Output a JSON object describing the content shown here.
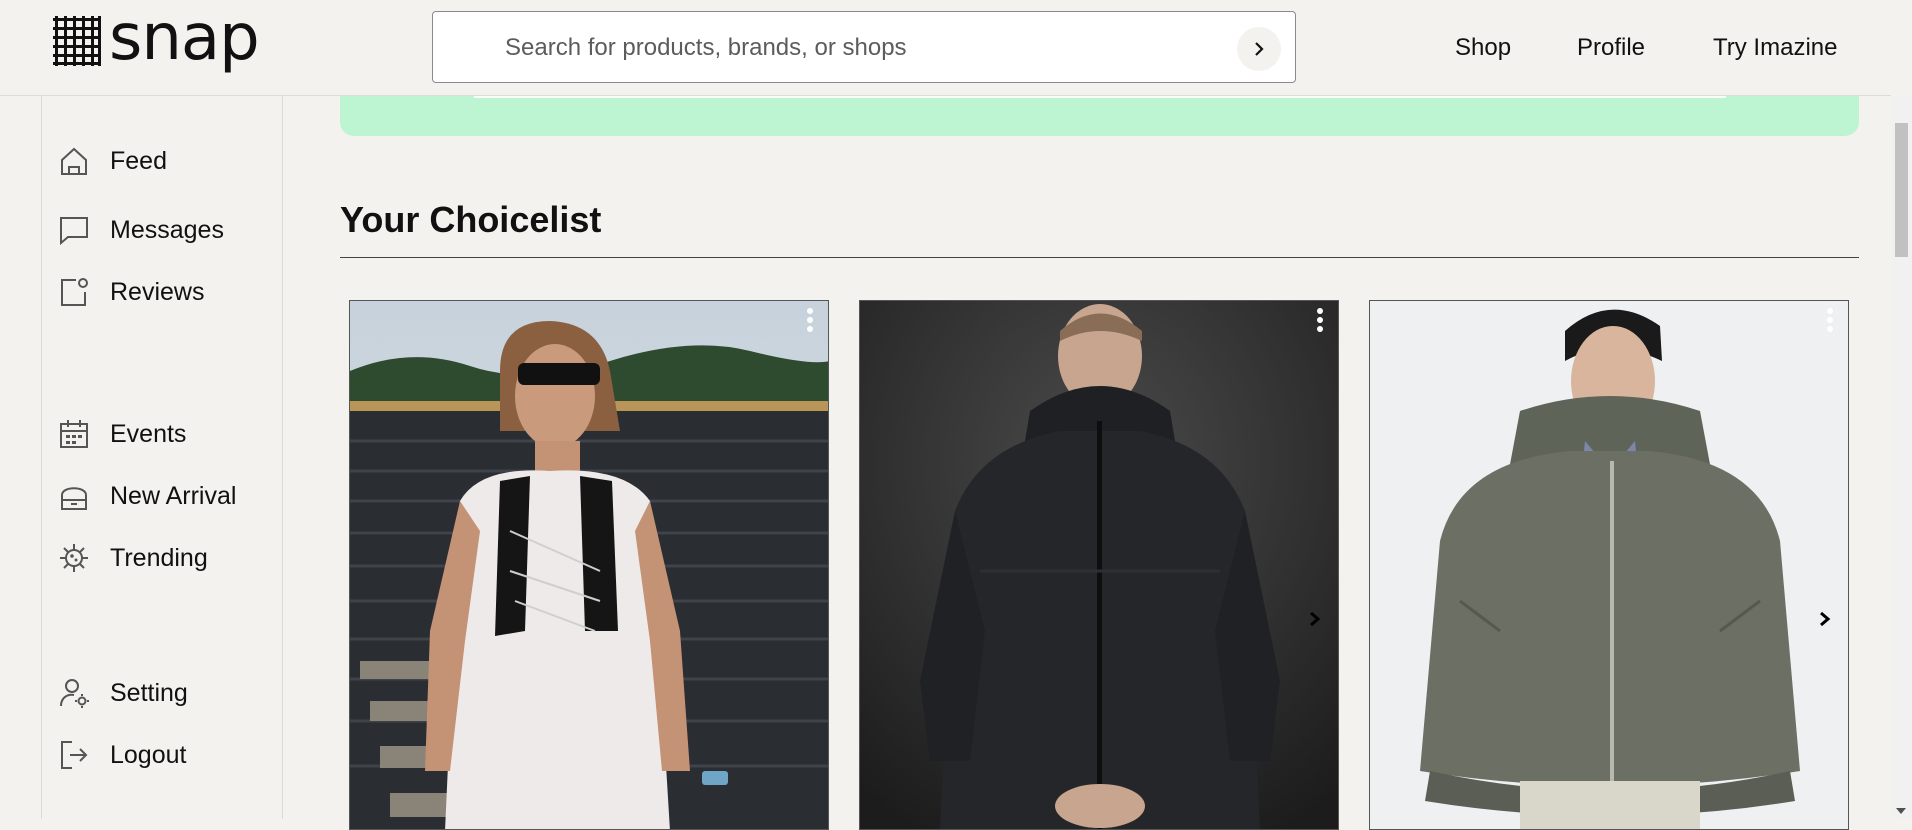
{
  "header": {
    "logo_text": "snap",
    "search": {
      "placeholder": "Search for products, brands, or shops"
    },
    "nav": [
      {
        "label": "Shop"
      },
      {
        "label": "Profile"
      },
      {
        "label": "Try Imazine"
      }
    ]
  },
  "sidebar": {
    "items": [
      {
        "label": "Feed",
        "icon": "home-icon"
      },
      {
        "label": "Messages",
        "icon": "message-icon"
      },
      {
        "label": "Reviews",
        "icon": "reviews-icon"
      },
      {
        "label": "Events",
        "icon": "calendar-icon"
      },
      {
        "label": "New Arrival",
        "icon": "store-icon"
      },
      {
        "label": "Trending",
        "icon": "virus-icon"
      },
      {
        "label": "Setting",
        "icon": "user-settings-icon"
      },
      {
        "label": "Logout",
        "icon": "logout-icon"
      }
    ]
  },
  "main": {
    "section_title": "Your Choicelist",
    "banner_color": "#bdf5d2",
    "cards": [
      {
        "image": "man-in-white-tank-and-black-vest-photo",
        "kebab_color": "#ffffff"
      },
      {
        "image": "man-in-black-rain-jacket-photo",
        "kebab_color": "#ffffff"
      },
      {
        "image": "man-in-grey-hooded-jacket-photo",
        "kebab_color": "#ffffff"
      }
    ]
  }
}
